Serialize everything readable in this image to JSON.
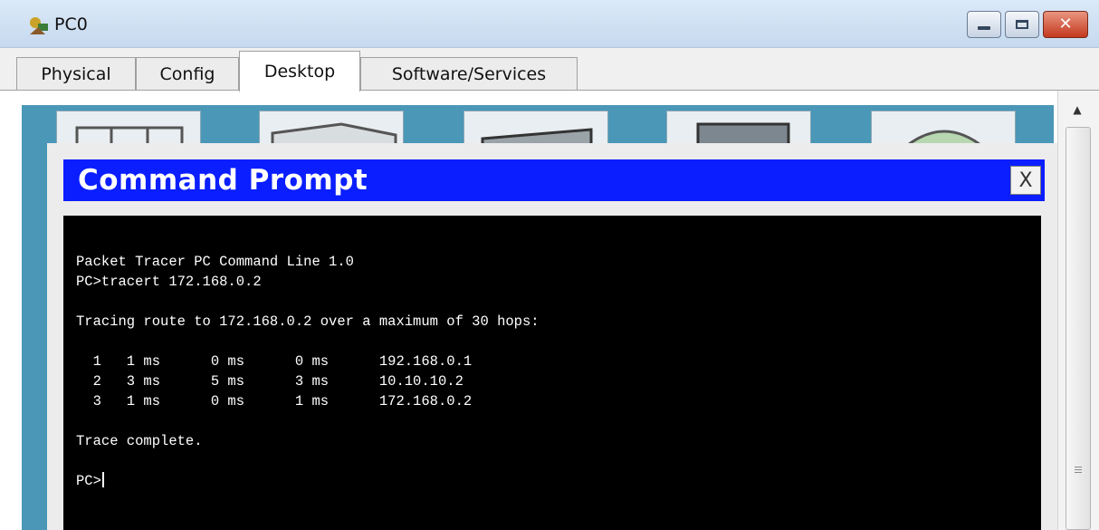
{
  "window": {
    "title": "PC0",
    "icon": "pc-icon",
    "close_label": "✕"
  },
  "tabs": [
    {
      "label": "Physical",
      "active": false
    },
    {
      "label": "Config",
      "active": false
    },
    {
      "label": "Desktop",
      "active": true
    },
    {
      "label": "Software/Services",
      "active": false
    }
  ],
  "command_prompt": {
    "title": "Command Prompt",
    "close_label": "X"
  },
  "terminal": {
    "lines": [
      "Packet Tracer PC Command Line 1.0",
      "PC>tracert 172.168.0.2",
      "",
      "Tracing route to 172.168.0.2 over a maximum of 30 hops:",
      "",
      "  1   1 ms      0 ms      0 ms      192.168.0.1",
      "  2   3 ms      5 ms      3 ms      10.10.10.2",
      "  3   1 ms      0 ms      1 ms      172.168.0.2",
      "",
      "Trace complete.",
      ""
    ],
    "prompt": "PC>"
  },
  "colors": {
    "header_blue": "#0a1eff",
    "desktop_bg": "#4a97b8",
    "terminal_bg": "#000000"
  }
}
